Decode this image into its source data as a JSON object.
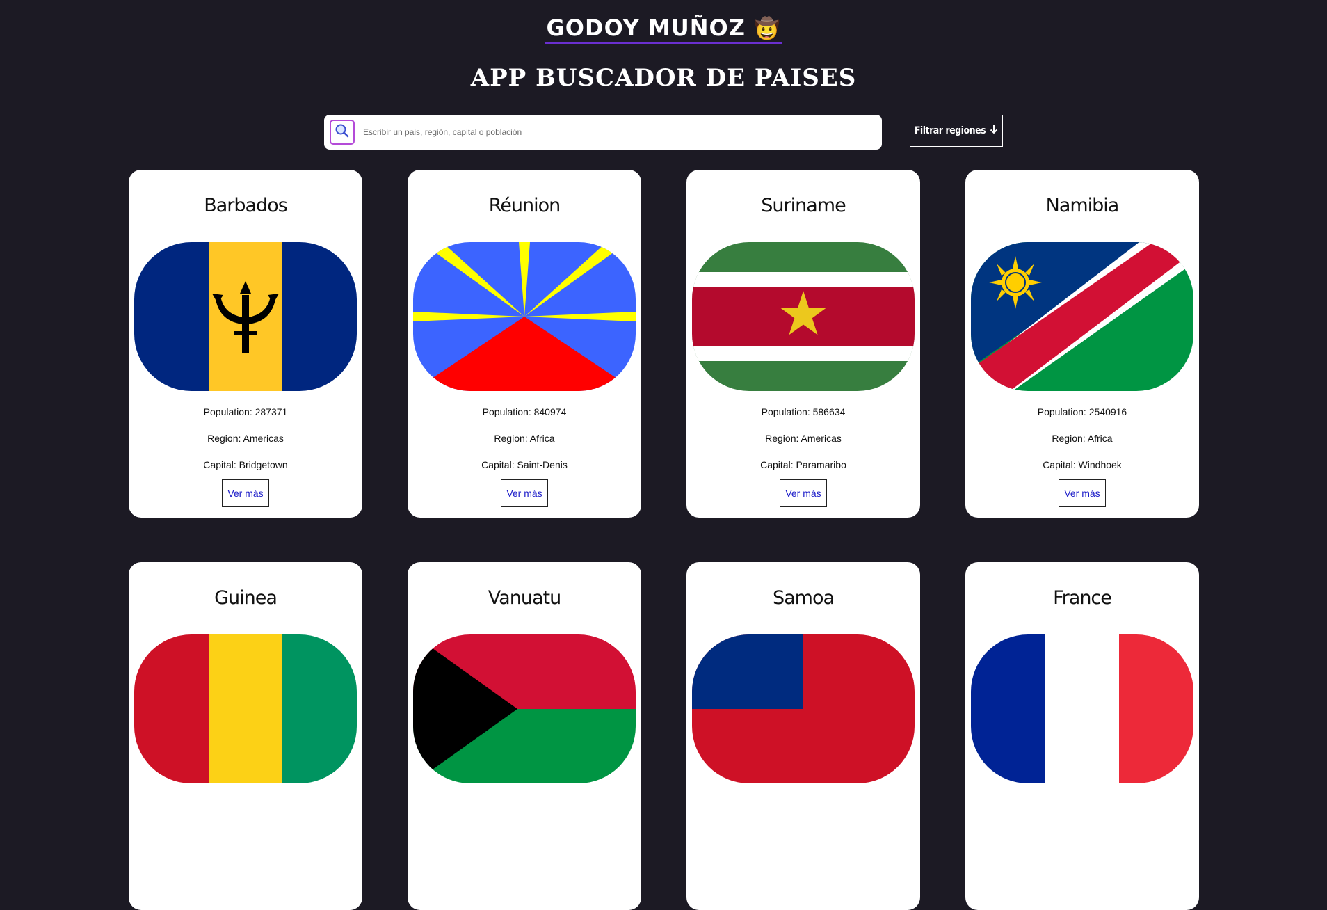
{
  "header": {
    "brand": "GODOY MUÑOZ",
    "brand_emoji": "🤠",
    "app_title": "APP BUSCADOR DE PAISES"
  },
  "search": {
    "placeholder": "Escribir un pais, región, capital o población",
    "value": ""
  },
  "filter": {
    "label": "Filtrar regiones"
  },
  "labels": {
    "population": "Population:",
    "region": "Region:",
    "capital": "Capital:",
    "more": "Ver más"
  },
  "countries": [
    {
      "name": "Barbados",
      "population": "287371",
      "region": "Americas",
      "capital": "Bridgetown"
    },
    {
      "name": "Réunion",
      "population": "840974",
      "region": "Africa",
      "capital": "Saint-Denis"
    },
    {
      "name": "Suriname",
      "population": "586634",
      "region": "Americas",
      "capital": "Paramaribo"
    },
    {
      "name": "Namibia",
      "population": "2540916",
      "region": "Africa",
      "capital": "Windhoek"
    },
    {
      "name": "Guinea"
    },
    {
      "name": "Vanuatu"
    },
    {
      "name": "Samoa"
    },
    {
      "name": "France"
    }
  ],
  "colors": {
    "background": "#1c1a24",
    "accent": "#6a2fd0",
    "link": "#1a1ac8"
  }
}
